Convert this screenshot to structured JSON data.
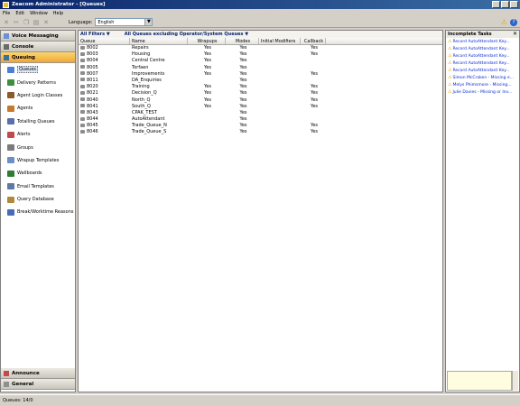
{
  "window": {
    "title": "Zeacom Administrator - [Queues]"
  },
  "menu": [
    "File",
    "Edit",
    "Window",
    "Help"
  ],
  "toolbar": {
    "language_label": "Language:",
    "language_value": "English"
  },
  "sidebar": {
    "voice_messaging": "Voice Messaging",
    "console": "Console",
    "queuing": "Queuing",
    "items": [
      {
        "label": "Queues",
        "icon": "queues-icon",
        "color": "#4a7fd1"
      },
      {
        "label": "Delivery Patterns",
        "icon": "delivery-patterns-icon",
        "color": "#3d8f3d"
      },
      {
        "label": "Agent Login Classes",
        "icon": "agent-login-classes-icon",
        "color": "#8b5a2b"
      },
      {
        "label": "Agents",
        "icon": "agents-icon",
        "color": "#c8782a"
      },
      {
        "label": "Totalling Queues",
        "icon": "totalling-queues-icon",
        "color": "#5a6fa8"
      },
      {
        "label": "Alerts",
        "icon": "alerts-icon",
        "color": "#c24a4a"
      },
      {
        "label": "Groups",
        "icon": "groups-icon",
        "color": "#7a7a7a"
      },
      {
        "label": "Wrapup Templates",
        "icon": "wrapup-templates-icon",
        "color": "#6a8fc9"
      },
      {
        "label": "Wallboards",
        "icon": "wallboards-icon",
        "color": "#2e7d32"
      },
      {
        "label": "Email Templates",
        "icon": "email-templates-icon",
        "color": "#5c7aa8"
      },
      {
        "label": "Query Database",
        "icon": "query-database-icon",
        "color": "#b08a3a"
      },
      {
        "label": "Break/Worktime Reasons",
        "icon": "break-reasons-icon",
        "color": "#4a6ab8"
      }
    ],
    "announce": "Announce",
    "general": "General"
  },
  "filters": {
    "left": "All Filters",
    "right": "All Queues excluding Operator/System Queues"
  },
  "grid": {
    "columns": [
      "Queue",
      "Name",
      "Wrapups",
      "Modes",
      "Initial Modifiers",
      "Callback"
    ],
    "rows": [
      {
        "queue": "8002",
        "name": "Repairs",
        "wrapups": "Yes",
        "modes": "Yes",
        "initial": "",
        "callback": "Yes"
      },
      {
        "queue": "8003",
        "name": "Housing",
        "wrapups": "Yes",
        "modes": "Yes",
        "initial": "",
        "callback": "Yes"
      },
      {
        "queue": "8004",
        "name": "Central Centre",
        "wrapups": "Yes",
        "modes": "Yes",
        "initial": "",
        "callback": ""
      },
      {
        "queue": "8005",
        "name": "Torfaen",
        "wrapups": "Yes",
        "modes": "Yes",
        "initial": "",
        "callback": ""
      },
      {
        "queue": "8007",
        "name": "Improvements",
        "wrapups": "Yes",
        "modes": "Yes",
        "initial": "",
        "callback": "Yes"
      },
      {
        "queue": "8011",
        "name": "DA_Enquiries",
        "wrapups": "",
        "modes": "Yes",
        "initial": "",
        "callback": ""
      },
      {
        "queue": "8020",
        "name": "Training",
        "wrapups": "Yes",
        "modes": "Yes",
        "initial": "",
        "callback": "Yes"
      },
      {
        "queue": "8021",
        "name": "Decision_Q",
        "wrapups": "Yes",
        "modes": "Yes",
        "initial": "",
        "callback": "Yes"
      },
      {
        "queue": "8040",
        "name": "North_Q",
        "wrapups": "Yes",
        "modes": "Yes",
        "initial": "",
        "callback": "Yes"
      },
      {
        "queue": "8041",
        "name": "South_Q",
        "wrapups": "Yes",
        "modes": "Yes",
        "initial": "",
        "callback": "Yes"
      },
      {
        "queue": "8043",
        "name": "CPAK_TEST",
        "wrapups": "",
        "modes": "Yes",
        "initial": "",
        "callback": ""
      },
      {
        "queue": "8044",
        "name": "AutoAttendant",
        "wrapups": "",
        "modes": "Yes",
        "initial": "",
        "callback": ""
      },
      {
        "queue": "8045",
        "name": "Trade_Queue_N",
        "wrapups": "",
        "modes": "Yes",
        "initial": "",
        "callback": "Yes"
      },
      {
        "queue": "8046",
        "name": "Trade_Queue_S",
        "wrapups": "",
        "modes": "Yes",
        "initial": "",
        "callback": "Yes"
      }
    ]
  },
  "tasks": {
    "title": "Incomplete Tasks",
    "items": [
      "Record AutoAttendant Key...",
      "Record AutoAttendant Key...",
      "Record AutoAttendant Key...",
      "Record AutoAttendant Key...",
      "Record AutoAttendant Key...",
      "Simon McCraken - Missing e...",
      "Melys Phimsmore - Missing...",
      "Julie Davies - Missing or Inv..."
    ]
  },
  "status": {
    "text": "Queues: 14/0"
  }
}
